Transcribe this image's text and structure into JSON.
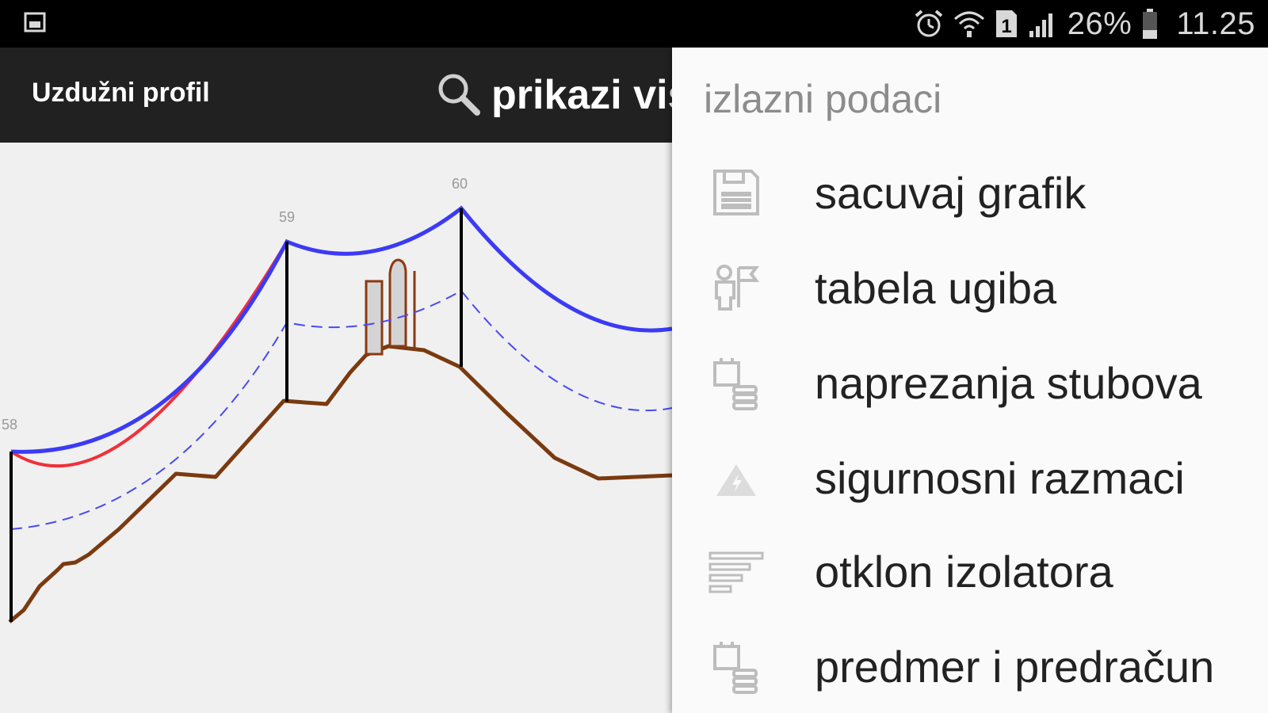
{
  "status_bar": {
    "left_icon": "image-icon",
    "icons": [
      "alarm-icon",
      "wifi-icon",
      "sim-1-icon",
      "signal-icon"
    ],
    "battery": "26%",
    "time": "11.25"
  },
  "action_bar": {
    "title": "Uzdužni profil",
    "search_icon": "search-icon",
    "search_label": "prikazi vis"
  },
  "chart": {
    "pole_labels": [
      "58",
      "59",
      "60"
    ],
    "colors": {
      "conductor_top": "#3b3bf5",
      "conductor_red": "#f0303a",
      "conductor_dashed": "#4a4af0",
      "terrain": "#7a3a10",
      "pole": "#000000",
      "building_fill": "#d4d4d4",
      "building_stroke": "#8a3a12"
    }
  },
  "menu": {
    "header": "izlazni podaci",
    "items": [
      {
        "label": "sacuvaj grafik",
        "icon": "floppy-disk-icon"
      },
      {
        "label": "tabela ugiba",
        "icon": "person-flag-icon"
      },
      {
        "label": "naprezanja stubova",
        "icon": "pole-stack-icon"
      },
      {
        "label": "sigurnosni razmaci",
        "icon": "warning-triangle-icon"
      },
      {
        "label": "otklon izolatora",
        "icon": "text-lines-icon"
      },
      {
        "label": "predmer i predračun",
        "icon": "pole-stack-icon"
      }
    ]
  }
}
